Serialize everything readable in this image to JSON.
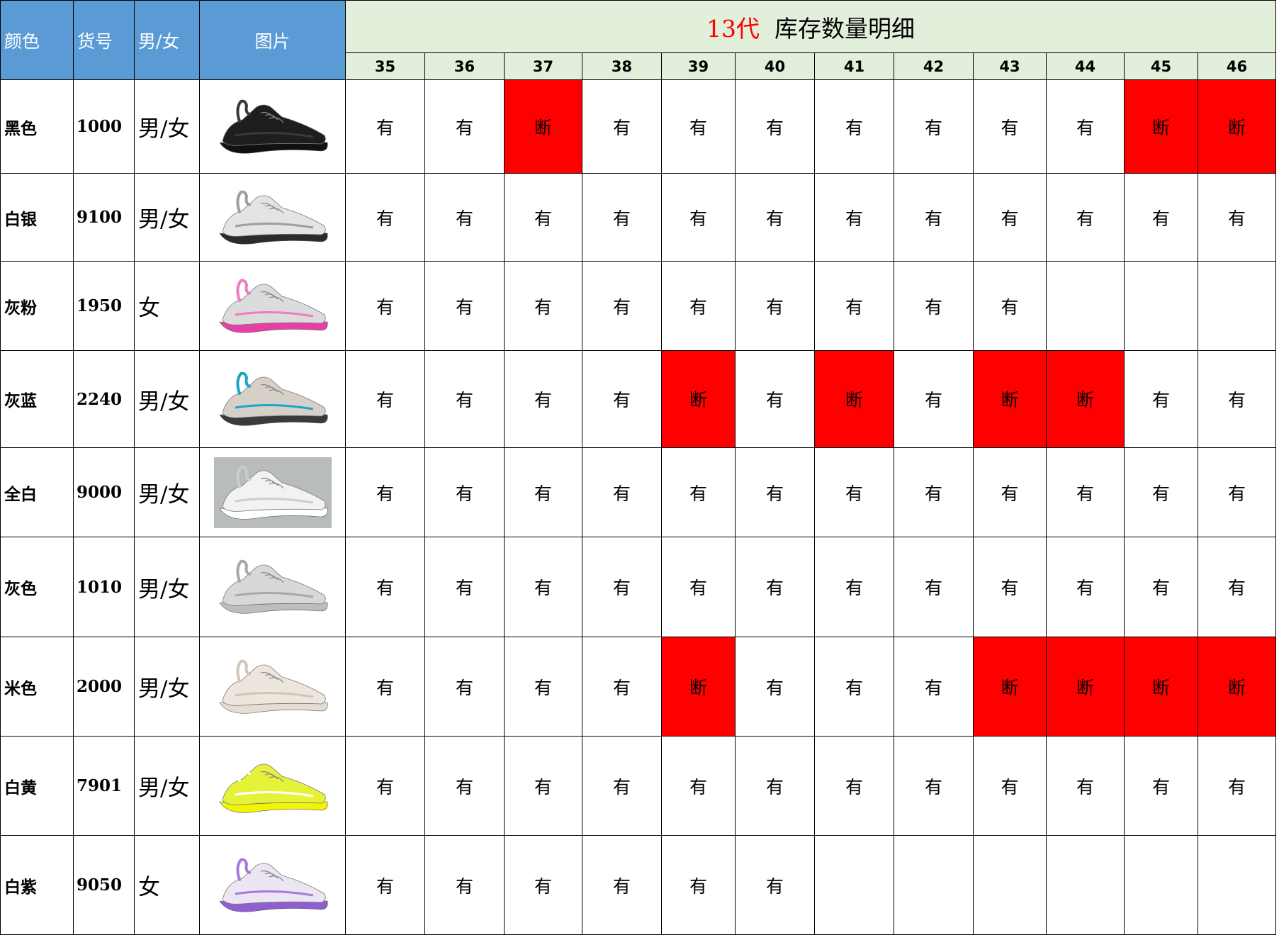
{
  "header": {
    "col_color": "颜色",
    "col_code": "货号",
    "col_gender": "男/女",
    "col_picture": "图片",
    "title_prefix": "13代",
    "title_main": "库存数量明细",
    "sizes": [
      "35",
      "36",
      "37",
      "38",
      "39",
      "40",
      "41",
      "42",
      "43",
      "44",
      "45",
      "46"
    ]
  },
  "colors": {
    "in_stock_bg": "#ffffff",
    "out_of_stock_bg": "#ff0000",
    "header_blue": "#5b9bd5",
    "header_green": "#e2efda",
    "title_accent": "#ff0000"
  },
  "rows": [
    {
      "color": "黑色",
      "code": "1000",
      "gender": "男/女",
      "picture": "black-sneaker",
      "stock": [
        "有",
        "有",
        "断",
        "有",
        "有",
        "有",
        "有",
        "有",
        "有",
        "有",
        "断",
        "断"
      ]
    },
    {
      "color": "白银",
      "code": "9100",
      "gender": "男/女",
      "picture": "white-silver-sneaker",
      "stock": [
        "有",
        "有",
        "有",
        "有",
        "有",
        "有",
        "有",
        "有",
        "有",
        "有",
        "有",
        "有"
      ]
    },
    {
      "color": "灰粉",
      "code": "1950",
      "gender": "女",
      "picture": "grey-pink-sneaker",
      "stock": [
        "有",
        "有",
        "有",
        "有",
        "有",
        "有",
        "有",
        "有",
        "有",
        "",
        "",
        ""
      ]
    },
    {
      "color": "灰蓝",
      "code": "2240",
      "gender": "男/女",
      "picture": "grey-blue-sneaker",
      "stock": [
        "有",
        "有",
        "有",
        "有",
        "断",
        "有",
        "断",
        "有",
        "断",
        "断",
        "有",
        "有"
      ]
    },
    {
      "color": "全白",
      "code": "9000",
      "gender": "男/女",
      "picture": "all-white-sneaker-photo",
      "stock": [
        "有",
        "有",
        "有",
        "有",
        "有",
        "有",
        "有",
        "有",
        "有",
        "有",
        "有",
        "有"
      ]
    },
    {
      "color": "灰色",
      "code": "1010",
      "gender": "男/女",
      "picture": "grey-sneaker",
      "stock": [
        "有",
        "有",
        "有",
        "有",
        "有",
        "有",
        "有",
        "有",
        "有",
        "有",
        "有",
        "有"
      ]
    },
    {
      "color": "米色",
      "code": "2000",
      "gender": "男/女",
      "picture": "beige-sneaker",
      "stock": [
        "有",
        "有",
        "有",
        "有",
        "断",
        "有",
        "有",
        "有",
        "断",
        "断",
        "断",
        "断"
      ]
    },
    {
      "color": "白黄",
      "code": "7901",
      "gender": "男/女",
      "picture": "white-yellow-sneaker",
      "stock": [
        "有",
        "有",
        "有",
        "有",
        "有",
        "有",
        "有",
        "有",
        "有",
        "有",
        "有",
        "有"
      ]
    },
    {
      "color": "白紫",
      "code": "9050",
      "gender": "女",
      "picture": "white-purple-sneaker",
      "stock": [
        "有",
        "有",
        "有",
        "有",
        "有",
        "有",
        "",
        "",
        "",
        "",
        "",
        ""
      ]
    }
  ]
}
